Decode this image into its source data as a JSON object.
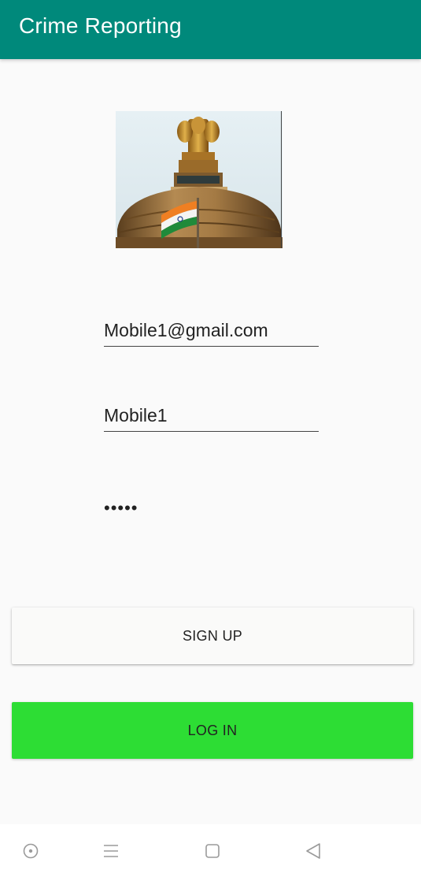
{
  "app_bar": {
    "title": "Crime Reporting",
    "background": "#00897b"
  },
  "emblem": {
    "icon": "state-emblem-dome-image"
  },
  "form": {
    "email_value": "Mobile1@gmail.com",
    "username_value": "Mobile1",
    "password_value": "•••••"
  },
  "buttons": {
    "signup_label": "SIGN UP",
    "login_label": "LOG IN",
    "login_color": "#2ddd34"
  },
  "nav_bar": {
    "icons": [
      "assistant-icon",
      "menu-icon",
      "home-square-icon",
      "back-triangle-icon"
    ]
  }
}
